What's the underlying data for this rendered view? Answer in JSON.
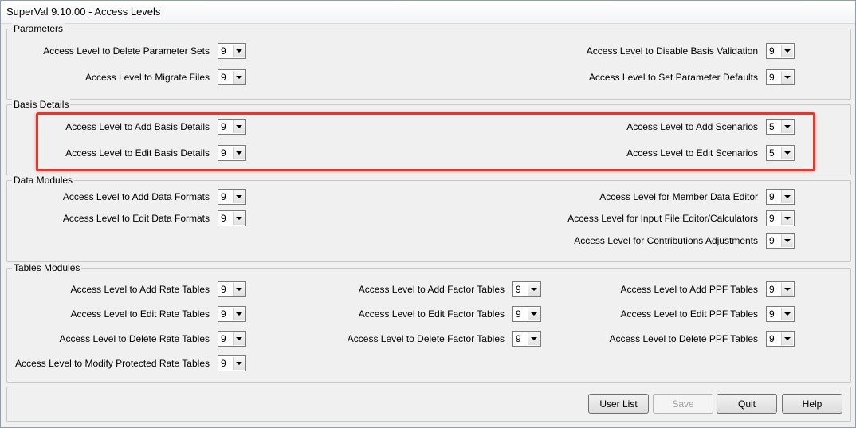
{
  "window": {
    "title": "SuperVal  9.10.00 - Access Levels"
  },
  "groups": {
    "parameters": "Parameters",
    "basis_details": "Basis Details",
    "data_modules": "Data Modules",
    "tables_modules": "Tables Modules"
  },
  "fields": {
    "delete_param_sets": {
      "label": "Access Level to Delete Parameter Sets",
      "value": "9"
    },
    "migrate_files": {
      "label": "Access Level to Migrate Files",
      "value": "9"
    },
    "disable_basis_validation": {
      "label": "Access Level to Disable Basis Validation",
      "value": "9"
    },
    "set_param_defaults": {
      "label": "Access Level to Set Parameter Defaults",
      "value": "9"
    },
    "add_basis_details": {
      "label": "Access Level to Add Basis Details",
      "value": "9"
    },
    "edit_basis_details": {
      "label": "Access Level to Edit Basis Details",
      "value": "9"
    },
    "add_scenarios": {
      "label": "Access Level to Add Scenarios",
      "value": "5"
    },
    "edit_scenarios": {
      "label": "Access Level to Edit Scenarios",
      "value": "5"
    },
    "add_data_formats": {
      "label": "Access Level to Add Data Formats",
      "value": "9"
    },
    "edit_data_formats": {
      "label": "Access Level to Edit Data Formats",
      "value": "9"
    },
    "member_data_editor": {
      "label": "Access Level for Member Data Editor",
      "value": "9"
    },
    "input_file_editor": {
      "label": "Access Level for Input File Editor/Calculators",
      "value": "9"
    },
    "contributions_adjustments": {
      "label": "Access Level for Contributions Adjustments",
      "value": "9"
    },
    "add_rate_tables": {
      "label": "Access Level to Add Rate Tables",
      "value": "9"
    },
    "edit_rate_tables": {
      "label": "Access Level to Edit Rate Tables",
      "value": "9"
    },
    "delete_rate_tables": {
      "label": "Access Level to Delete Rate Tables",
      "value": "9"
    },
    "modify_protected_rate_tables": {
      "label": "Access Level to Modify Protected Rate Tables",
      "value": "9"
    },
    "add_factor_tables": {
      "label": "Access Level to Add Factor Tables",
      "value": "9"
    },
    "edit_factor_tables": {
      "label": "Access Level to Edit Factor Tables",
      "value": "9"
    },
    "delete_factor_tables": {
      "label": "Access Level to Delete Factor Tables",
      "value": "9"
    },
    "add_ppf_tables": {
      "label": "Access Level to Add PPF Tables",
      "value": "9"
    },
    "edit_ppf_tables": {
      "label": "Access Level to Edit PPF Tables",
      "value": "9"
    },
    "delete_ppf_tables": {
      "label": "Access Level to Delete PPF Tables",
      "value": "9"
    }
  },
  "buttons": {
    "user_list": "User List",
    "save": "Save",
    "quit": "Quit",
    "help": "Help"
  }
}
